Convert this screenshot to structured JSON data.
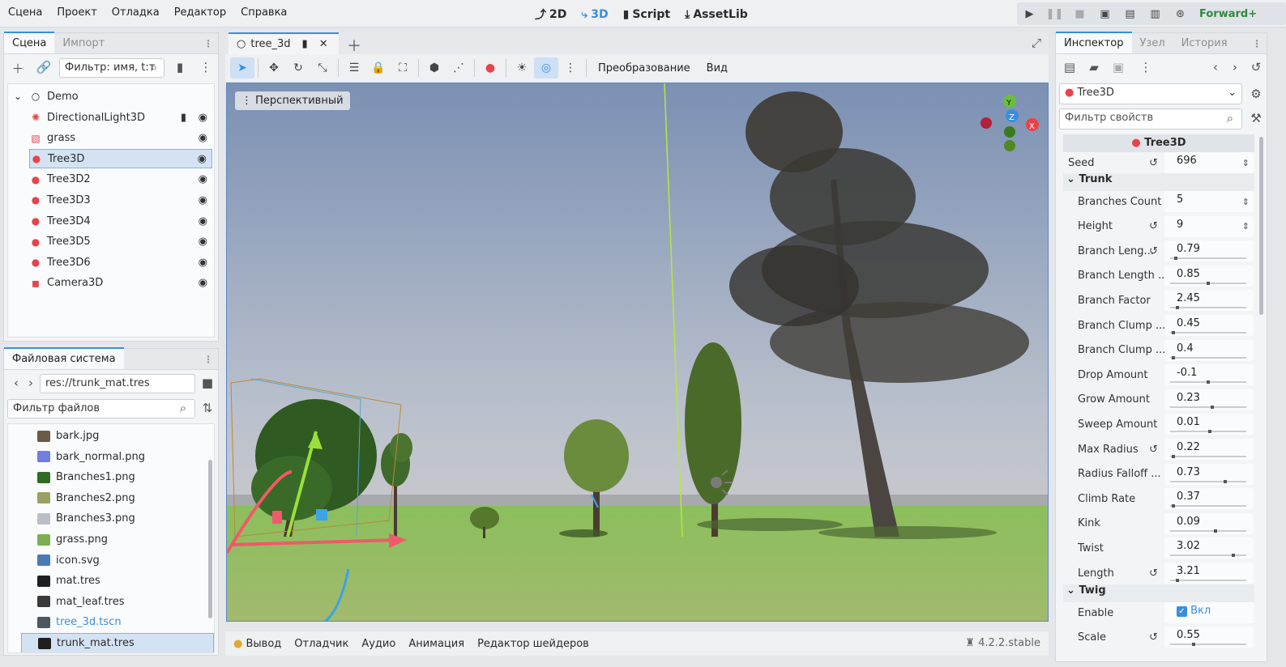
{
  "menu": [
    "Сцена",
    "Проект",
    "Отладка",
    "Редактор",
    "Справка"
  ],
  "workspaces": {
    "w2d": "2D",
    "w3d": "3D",
    "script": "Script",
    "assetlib": "AssetLib"
  },
  "renderer": "Forward+",
  "scene_panel": {
    "tabs": [
      "Сцена",
      "Импорт"
    ],
    "filter_placeholder": "Фильтр: имя, t:т",
    "root": "Demo",
    "nodes": [
      {
        "name": "DirectionalLight3D",
        "icon": "light-icon",
        "color": "#e8434a",
        "script": true
      },
      {
        "name": "grass",
        "icon": "mesh-icon",
        "color": "#e8434a",
        "script": false
      },
      {
        "name": "Tree3D",
        "icon": "tree-icon",
        "color": "#e8434a",
        "script": false
      },
      {
        "name": "Tree3D2",
        "icon": "tree-icon",
        "color": "#e8434a",
        "script": false
      },
      {
        "name": "Tree3D3",
        "icon": "tree-icon",
        "color": "#e8434a",
        "script": false
      },
      {
        "name": "Tree3D4",
        "icon": "tree-icon",
        "color": "#e8434a",
        "script": false
      },
      {
        "name": "Tree3D5",
        "icon": "tree-icon",
        "color": "#e8434a",
        "script": false
      },
      {
        "name": "Tree3D6",
        "icon": "tree-icon",
        "color": "#e8434a",
        "script": false
      },
      {
        "name": "Camera3D",
        "icon": "camera-icon",
        "color": "#e8434a",
        "script": false
      }
    ]
  },
  "filesystem": {
    "title": "Файловая система",
    "path": "res://trunk_mat.tres",
    "filter_placeholder": "Фильтр файлов",
    "files": [
      {
        "name": "bark.jpg",
        "color": "#6b5a44"
      },
      {
        "name": "bark_normal.png",
        "color": "#6f7ee0"
      },
      {
        "name": "Branches1.png",
        "color": "#2f6b25"
      },
      {
        "name": "Branches2.png",
        "color": "#9aa060"
      },
      {
        "name": "Branches3.png",
        "color": "#b9bfc4"
      },
      {
        "name": "grass.png",
        "color": "#7eae52"
      },
      {
        "name": "icon.svg",
        "color": "#4a79b8"
      },
      {
        "name": "mat.tres",
        "color": "#1f1f1f"
      },
      {
        "name": "mat_leaf.tres",
        "color": "#3a3a3a"
      },
      {
        "name": "tree_3d.tscn",
        "color": "#4e5660"
      },
      {
        "name": "trunk_mat.tres",
        "color": "#1f1f1f"
      }
    ]
  },
  "editor": {
    "tab": "tree_3d",
    "toolbar_transform": "Преобразование",
    "toolbar_view": "Вид",
    "perspective": "Перспективный",
    "bottom_tabs": [
      "Вывод",
      "Отладчик",
      "Аудио",
      "Анимация",
      "Редактор шейдеров"
    ],
    "version": "4.2.2.stable"
  },
  "inspector": {
    "tabs": [
      "Инспектор",
      "Узел",
      "История"
    ],
    "object": "Tree3D",
    "filter_placeholder": "Фильтр свойств",
    "header": "Tree3D",
    "seed_label": "Seed",
    "seed": "696",
    "trunk_section": "Trunk",
    "twig_section": "Twig",
    "props": [
      {
        "label": "Branches Count",
        "value": "5",
        "type": "spin",
        "revert": false
      },
      {
        "label": "Height",
        "value": "9",
        "type": "spin",
        "revert": true
      },
      {
        "label": "Branch Leng...",
        "value": "0.79",
        "type": "slider",
        "fraction": 0.06,
        "revert": true
      },
      {
        "label": "Branch Length ...",
        "value": "0.85",
        "type": "slider",
        "fraction": 0.5,
        "revert": false
      },
      {
        "label": "Branch Factor",
        "value": "2.45",
        "type": "slider",
        "fraction": 0.08,
        "revert": false
      },
      {
        "label": "Branch Clump ...",
        "value": "0.45",
        "type": "slider",
        "fraction": 0.02,
        "revert": false
      },
      {
        "label": "Branch Clump ...",
        "value": "0.4",
        "type": "slider",
        "fraction": 0.02,
        "revert": false
      },
      {
        "label": "Drop Amount",
        "value": "-0.1",
        "type": "slider",
        "fraction": 0.5,
        "revert": false
      },
      {
        "label": "Grow Amount",
        "value": "0.23",
        "type": "slider",
        "fraction": 0.55,
        "revert": false
      },
      {
        "label": "Sweep Amount",
        "value": "0.01",
        "type": "slider",
        "fraction": 0.52,
        "revert": false
      },
      {
        "label": "Max Radius",
        "value": "0.22",
        "type": "slider",
        "fraction": 0.02,
        "revert": true
      },
      {
        "label": "Radius Falloff ...",
        "value": "0.73",
        "type": "slider",
        "fraction": 0.73,
        "revert": false
      },
      {
        "label": "Climb Rate",
        "value": "0.37",
        "type": "slider",
        "fraction": 0.02,
        "revert": false
      },
      {
        "label": "Kink",
        "value": "0.09",
        "type": "slider",
        "fraction": 0.6,
        "revert": false
      },
      {
        "label": "Twist",
        "value": "3.02",
        "type": "slider",
        "fraction": 0.84,
        "revert": false
      },
      {
        "label": "Length",
        "value": "3.21",
        "type": "slider",
        "fraction": 0.08,
        "revert": true
      }
    ],
    "twig_enable_label": "Enable",
    "twig_enable_value": "Вкл",
    "twig_scale_label": "Scale",
    "twig_scale": "0.55",
    "twig_scale_fraction": 0.3
  }
}
